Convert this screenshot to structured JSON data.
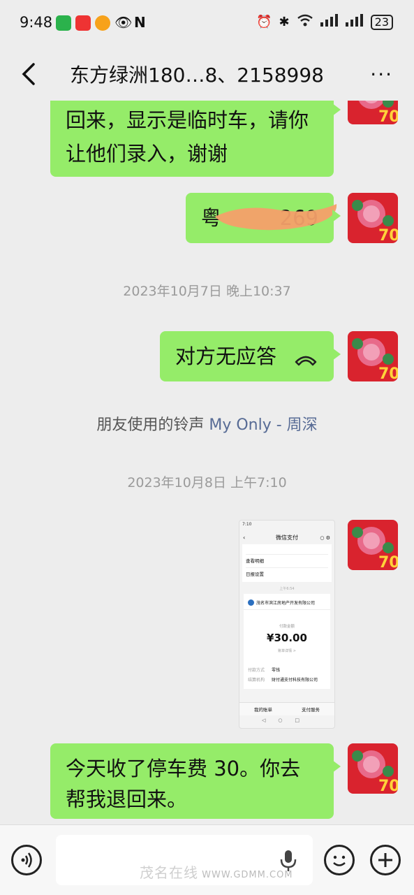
{
  "status_bar": {
    "time": "9:48",
    "battery": "23"
  },
  "nav": {
    "title": "东方绿洲180…8、2158998",
    "more": "···"
  },
  "messages": {
    "m1_line1": "回来，显示是临时车，请你",
    "m1_line2": "让他们录入，谢谢",
    "m2_text": "粤",
    "m2_tail": "269",
    "ts1": "2023年10月7日 晚上10:37",
    "m3_text": "对方无应答",
    "ring_prefix": "朋友使用的铃声 ",
    "ring_song": "My Only - 周深",
    "ts2": "2023年10月8日 上午7:10",
    "m5_line1": "今天收了停车费 30。你去",
    "m5_line2": "帮我退回来。"
  },
  "screenshot": {
    "time": "7:10",
    "title": "微信支付",
    "item1": "查看明细",
    "item2": "日报设置",
    "date": "上午6:54",
    "merchant": "茂名市滨江房地产开发有限公司",
    "amount_label": "付款金额",
    "amount": "¥30.00",
    "detail_link": "账单详情 >",
    "pay_method_label": "付款方式",
    "pay_method": "零钱",
    "clear_label": "结算机构",
    "clear_org": "财付通支付科技有限公司",
    "tab1": "我的账单",
    "tab2": "支付服务"
  },
  "watermark": {
    "text": "茂名在线",
    "url": "WWW.GDMM.COM"
  },
  "colors": {
    "bubble": "#95ec69",
    "bg": "#ededed",
    "link": "#576b95"
  }
}
